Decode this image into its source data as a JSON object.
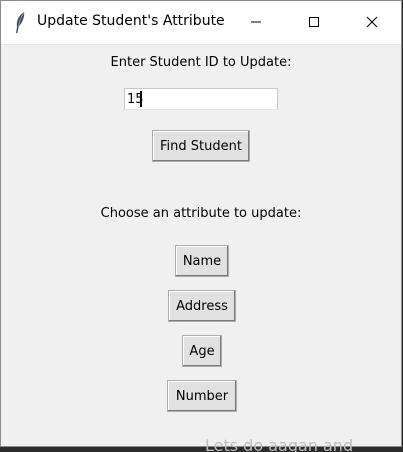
{
  "window": {
    "title": "Update Student's Attribute",
    "app_icon": "feather-icon",
    "controls": {
      "minimize_icon": "minimize-icon",
      "maximize_icon": "maximize-icon",
      "close_icon": "close-icon"
    }
  },
  "form": {
    "id_label": "Enter Student ID to Update:",
    "id_value": "15",
    "find_button": "Find Student",
    "choose_label": "Choose an attribute to update:",
    "attribute_buttons": [
      "Name",
      "Address",
      "Age",
      "Number"
    ]
  },
  "background": {
    "partial_text": "Lets do aagan and"
  },
  "colors": {
    "window_bg": "#f0f0f0",
    "titlebar_bg": "#ffffff",
    "button_bg": "#e1e1e1"
  }
}
